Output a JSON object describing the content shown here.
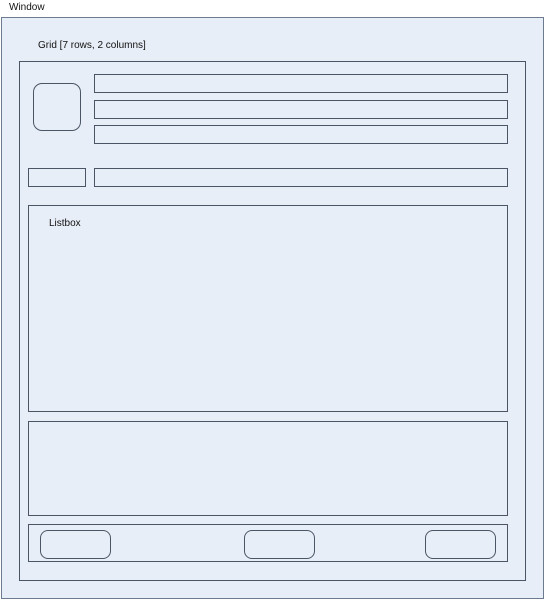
{
  "window": {
    "title": "Window"
  },
  "grid": {
    "label": "Grid [7 rows, 2 columns]"
  },
  "listbox": {
    "label": "Listbox"
  }
}
